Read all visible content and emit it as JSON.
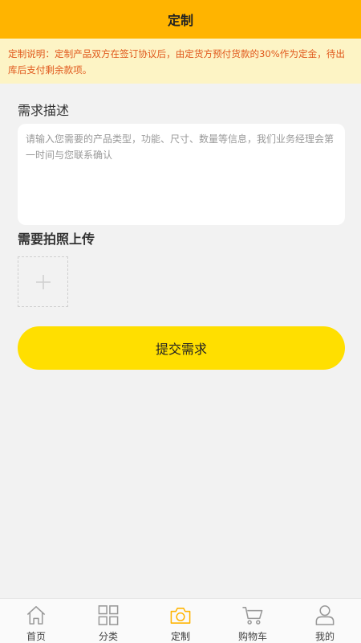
{
  "header": {
    "title": "定制"
  },
  "notice": {
    "text": "定制说明：定制产品双方在签订协议后，由定货方预付货款的30%作为定金，待出库后支付剩余款项。"
  },
  "form": {
    "description_title": "需求描述",
    "description_placeholder": "请输入您需要的产品类型，功能、尺寸、数量等信息，我们业务经理会第一时间与您联系确认",
    "photo_title": "需要拍照上传",
    "upload_icon": "plus-icon",
    "submit_label": "提交需求"
  },
  "tabbar": {
    "active_color": "#ffb400",
    "items": [
      {
        "label": "首页",
        "icon": "home-icon"
      },
      {
        "label": "分类",
        "icon": "grid-icon"
      },
      {
        "label": "定制",
        "icon": "camera-icon",
        "active": true
      },
      {
        "label": "购物车",
        "icon": "cart-icon"
      },
      {
        "label": "我的",
        "icon": "user-icon"
      }
    ]
  },
  "colors": {
    "header": "#ffb400",
    "notice_bg": "#fdf4c5",
    "notice_text": "#e0571b",
    "button": "#ffdf00"
  }
}
